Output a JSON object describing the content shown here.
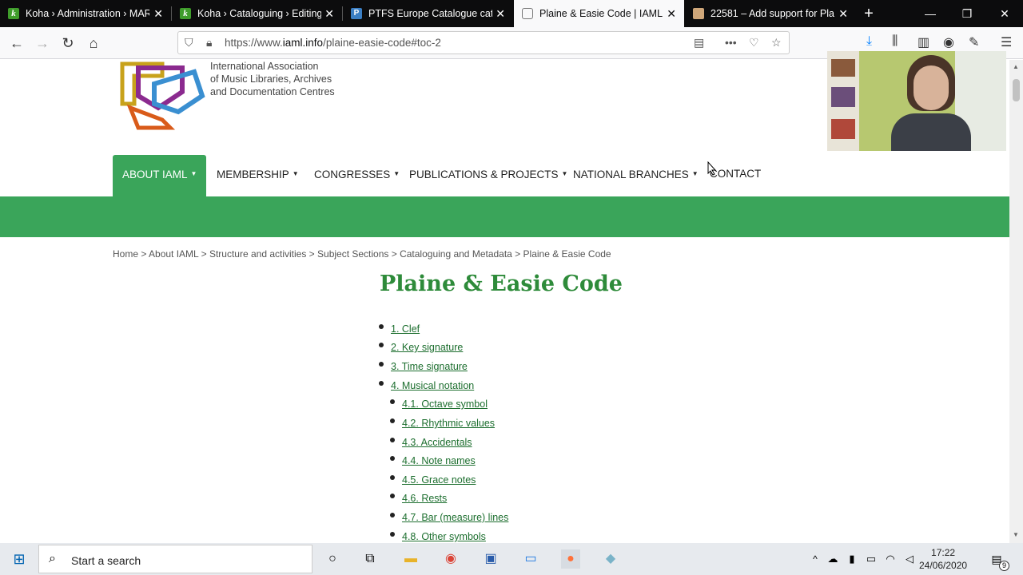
{
  "browser": {
    "tabs": [
      {
        "title": "Koha › Administration › MARC",
        "favicon": "koha-icon",
        "active": false
      },
      {
        "title": "Koha › Cataloguing › Editing",
        "favicon": "koha-icon",
        "active": false
      },
      {
        "title": "PTFS Europe Catalogue catal",
        "favicon": "ptfs-icon",
        "active": false
      },
      {
        "title": "Plaine & Easie Code | IAML",
        "favicon": "iaml-icon",
        "active": true
      },
      {
        "title": "22581 – Add support for Pla",
        "favicon": "bugzilla-icon",
        "active": false
      }
    ],
    "url_prefix": "https://www.",
    "url_domain": "iaml.info",
    "url_path": "/plaine-easie-code#toc-2"
  },
  "site": {
    "logo_line1": "International Association",
    "logo_line2": "of Music Libraries, Archives",
    "logo_line3": "and Documentation Centres",
    "menu": [
      {
        "label": "ABOUT IAML",
        "active": true
      },
      {
        "label": "MEMBERSHIP"
      },
      {
        "label": "CONGRESSES"
      },
      {
        "label": "PUBLICATIONS & PROJECTS"
      },
      {
        "label": "NATIONAL BRANCHES"
      },
      {
        "label": "CONTACT"
      }
    ],
    "brand_color": "#3aa55a"
  },
  "page": {
    "breadcrumb": "Home > About IAML > Structure and activities > Subject Sections > Cataloguing and Metadata > Plaine & Easie Code",
    "title": "Plaine & Easie Code",
    "toc": [
      {
        "label": "1. Clef",
        "level": 1
      },
      {
        "label": "2. Key signature",
        "level": 1
      },
      {
        "label": "3. Time signature",
        "level": 1
      },
      {
        "label": "4. Musical notation",
        "level": 1
      },
      {
        "label": "4.1. Octave symbol",
        "level": 2
      },
      {
        "label": "4.2. Rhythmic values",
        "level": 2
      },
      {
        "label": "4.3. Accidentals",
        "level": 2
      },
      {
        "label": "4.4. Note names",
        "level": 2
      },
      {
        "label": "4.5. Grace notes",
        "level": 2
      },
      {
        "label": "4.6. Rests",
        "level": 2
      },
      {
        "label": "4.7. Bar (measure) lines",
        "level": 2
      },
      {
        "label": "4.8. Other symbols",
        "level": 2
      }
    ]
  },
  "taskbar": {
    "search_placeholder": "Start a search",
    "time": "17:22",
    "date": "24/06/2020",
    "notification_count": "9"
  }
}
